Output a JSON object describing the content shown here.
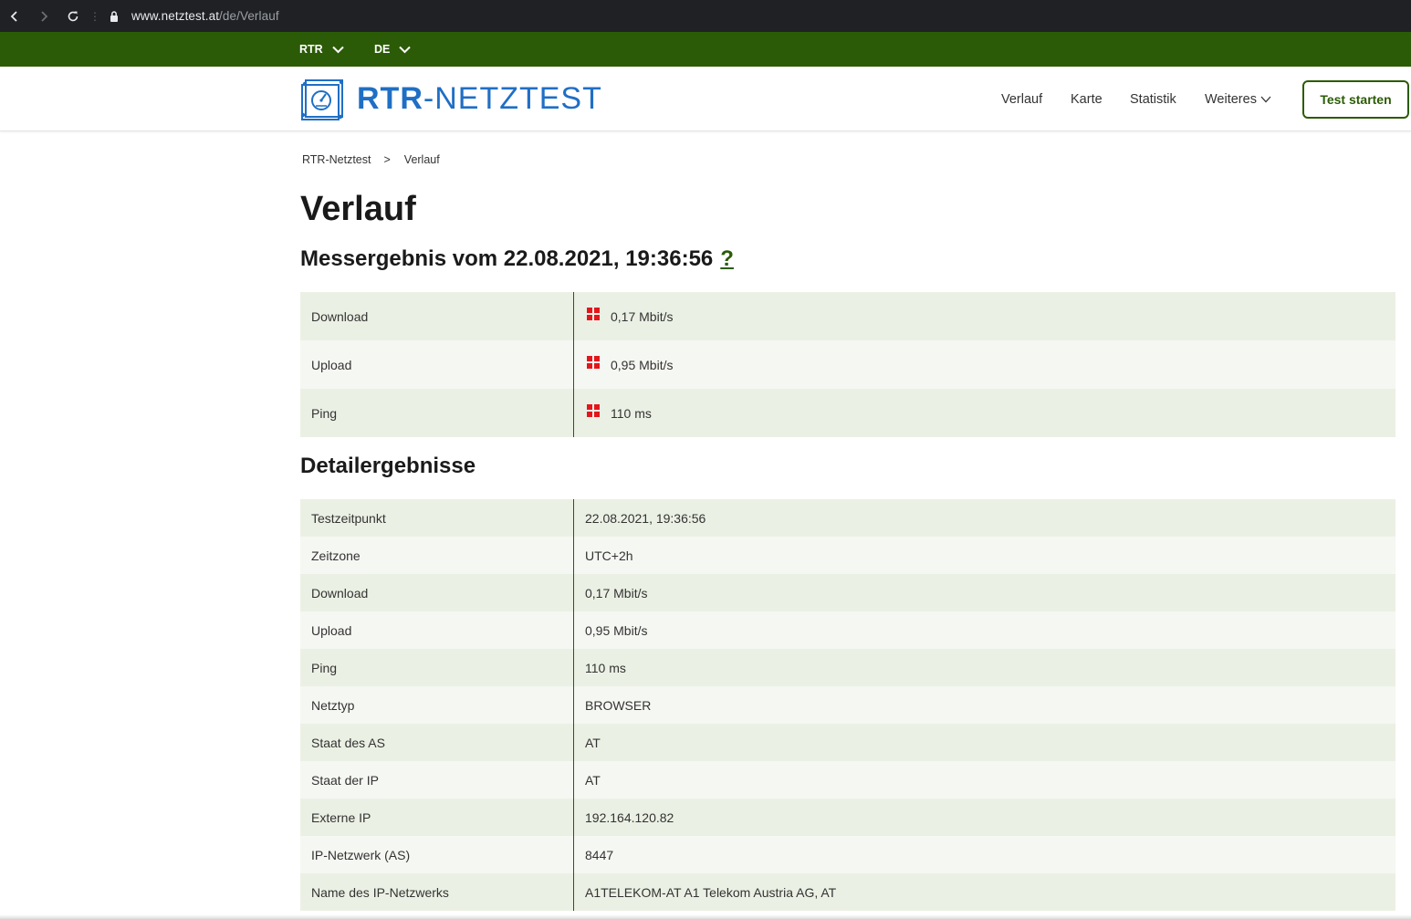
{
  "browser": {
    "url_host": "www.netztest.at",
    "url_path": "/de/Verlauf"
  },
  "topbar": {
    "org_label": "RTR",
    "lang_label": "DE"
  },
  "header": {
    "logo_bold": "RTR",
    "logo_rest": "-NETZTEST",
    "nav": [
      "Verlauf",
      "Karte",
      "Statistik",
      "Weiteres"
    ],
    "cta_label": "Test starten"
  },
  "breadcrumb": {
    "home": "RTR-Netztest",
    "separator": ">",
    "current": "Verlauf"
  },
  "page_title": "Verlauf",
  "result_heading": "Messergebnis vom 22.08.2021, 19:36:56",
  "help_label": "?",
  "summary": [
    {
      "label": "Download",
      "value": "0,17 Mbit/s",
      "rating_icon": "red-quality-icon"
    },
    {
      "label": "Upload",
      "value": "0,95 Mbit/s",
      "rating_icon": "red-quality-icon"
    },
    {
      "label": "Ping",
      "value": "110 ms",
      "rating_icon": "red-quality-icon"
    }
  ],
  "details_heading": "Detailergebnisse",
  "details": [
    {
      "label": "Testzeitpunkt",
      "value": "22.08.2021, 19:36:56"
    },
    {
      "label": "Zeitzone",
      "value": "UTC+2h"
    },
    {
      "label": "Download",
      "value": "0,17 Mbit/s"
    },
    {
      "label": "Upload",
      "value": "0,95 Mbit/s"
    },
    {
      "label": "Ping",
      "value": "110 ms"
    },
    {
      "label": "Netztyp",
      "value": "BROWSER"
    },
    {
      "label": "Staat des AS",
      "value": "AT"
    },
    {
      "label": "Staat der IP",
      "value": "AT"
    },
    {
      "label": "Externe IP",
      "value": "192.164.120.82"
    },
    {
      "label": "IP-Netzwerk (AS)",
      "value": "8447"
    },
    {
      "label": "Name des IP-Netzwerks",
      "value": "A1TELEKOM-AT A1 Telekom Austria AG, AT"
    }
  ],
  "colors": {
    "brand_green": "#2b5b06",
    "logo_blue": "#1f6fc5",
    "rating_red": "#e3161c",
    "row_odd": "#ebf0e4",
    "row_even": "#f5f7f2"
  }
}
